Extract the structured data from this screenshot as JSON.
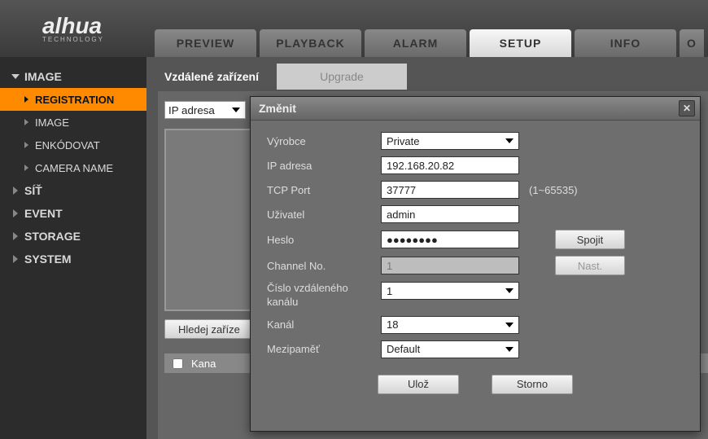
{
  "brand": {
    "name": "alhua",
    "sub": "TECHNOLOGY"
  },
  "topTabs": {
    "preview": "PREVIEW",
    "playback": "PLAYBACK",
    "alarm": "ALARM",
    "setup": "SETUP",
    "info": "INFO",
    "extra": "O"
  },
  "sidebar": {
    "image": "IMAGE",
    "subs": {
      "registration": "REGISTRATION",
      "image": "IMAGE",
      "encode": "ENKÓDOVAT",
      "camname": "CAMERA NAME"
    },
    "net": "SÍŤ",
    "event": "EVENT",
    "storage": "STORAGE",
    "system": "SYSTEM"
  },
  "innerTabs": {
    "remote": "Vzdálené zařízení",
    "upgrade": "Upgrade"
  },
  "page": {
    "ipFilterLabel": "IP adresa",
    "searchBtn": "Hledej zaříze",
    "colChannel": "Kana"
  },
  "dialog": {
    "title": "Změnit",
    "labels": {
      "manufacturer": "Výrobce",
      "ip": "IP adresa",
      "port": "TCP Port",
      "user": "Uživatel",
      "password": "Heslo",
      "channelNo": "Channel No.",
      "remoteChannel": "Číslo vzdáleného kanálu",
      "channel": "Kanál",
      "buffer": "Mezipaměť"
    },
    "values": {
      "manufacturer": "Private",
      "ip": "192.168.20.82",
      "port": "37777",
      "portHint": "(1~65535)",
      "user": "admin",
      "password": "●●●●●●●●",
      "channelNo": "1",
      "remoteChannel": "1",
      "channel": "18",
      "buffer": "Default"
    },
    "buttons": {
      "connect": "Spojit",
      "setup": "Nast.",
      "save": "Ulož",
      "cancel": "Storno"
    }
  }
}
